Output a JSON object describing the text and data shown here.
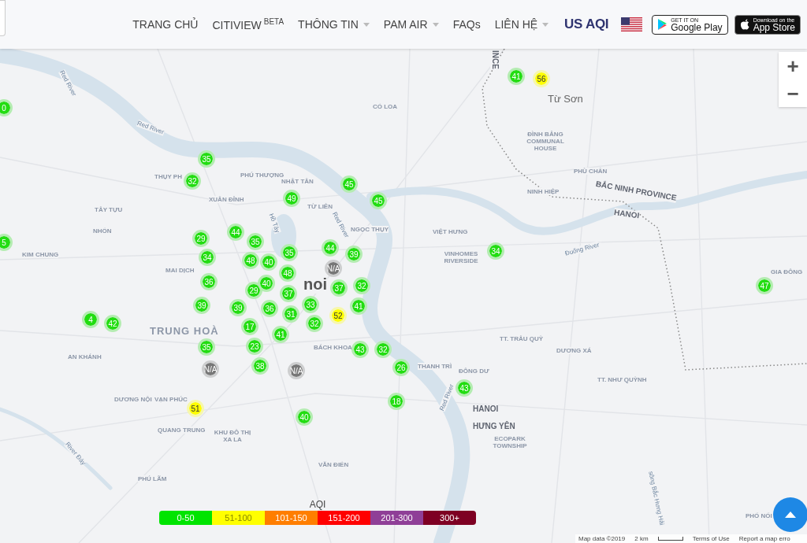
{
  "nav": {
    "items": [
      {
        "label": "TRANG CHỦ",
        "dropdown": false
      },
      {
        "label": "CITIVIEW",
        "badge": "BETA",
        "dropdown": false
      },
      {
        "label": "THÔNG TIN",
        "dropdown": true
      },
      {
        "label": "PAM AIR",
        "dropdown": true
      },
      {
        "label": "FAQs",
        "dropdown": false
      },
      {
        "label": "LIÊN HỆ",
        "dropdown": true
      }
    ],
    "aqi_logo": "US AQI",
    "store_badges": [
      {
        "kind": "google",
        "small": "GET IT ON",
        "big": "Google Play"
      },
      {
        "kind": "apple",
        "small": "Download on the",
        "big": "App Store"
      }
    ]
  },
  "zoom_controls": [
    "+",
    "−"
  ],
  "map": {
    "labels": [
      {
        "kind": "region",
        "text": "INCE"
      },
      {
        "kind": "water",
        "text": "Red River"
      },
      {
        "kind": "water",
        "text": "Red River"
      },
      {
        "kind": "place",
        "text": "CỔ LOA"
      },
      {
        "kind": "town",
        "text": "Từ Sơn"
      },
      {
        "kind": "place",
        "text": "ĐÌNH BẢNG COMMUNAL HOUSE"
      },
      {
        "kind": "place",
        "text": "THỤY PH"
      },
      {
        "kind": "place",
        "text": "PHÚ THƯỢNG"
      },
      {
        "kind": "place",
        "text": "PHÙ CHẨN"
      },
      {
        "kind": "region",
        "text": "BẮC NINH PROVINCE"
      },
      {
        "kind": "place",
        "text": "XUÂN ĐỈNH"
      },
      {
        "kind": "place",
        "text": "NHẬT TÂN"
      },
      {
        "kind": "place",
        "text": "NINH HIỆP"
      },
      {
        "kind": "place",
        "text": "TỪ LIÊN"
      },
      {
        "kind": "region",
        "text": "HANOI"
      },
      {
        "kind": "place",
        "text": "TÂY TỰU"
      },
      {
        "kind": "place",
        "text": "NHỔN"
      },
      {
        "kind": "place",
        "text": "NGỌC THỤY"
      },
      {
        "kind": "place",
        "text": "VIỆT HƯNG"
      },
      {
        "kind": "water",
        "text": "Hồ Tây"
      },
      {
        "kind": "water",
        "text": "Red River"
      },
      {
        "kind": "place",
        "text": "KIM CHUNG"
      },
      {
        "kind": "place",
        "text": "VINHOMES RIVERSIDE"
      },
      {
        "kind": "water",
        "text": "Đuống River"
      },
      {
        "kind": "place",
        "text": "MAI DỊCH"
      },
      {
        "kind": "place",
        "text": "GIA ĐÔNG"
      },
      {
        "kind": "city",
        "text": "noi"
      },
      {
        "kind": "district",
        "text": "TRUNG HOÀ"
      },
      {
        "kind": "place",
        "text": "BÁCH KHOA"
      },
      {
        "kind": "place",
        "text": "TT. TRÂU QUỲ"
      },
      {
        "kind": "place",
        "text": "DƯƠNG XÁ"
      },
      {
        "kind": "place",
        "text": "AN KHÁNH"
      },
      {
        "kind": "place",
        "text": "THANH TRÌ"
      },
      {
        "kind": "place",
        "text": "ĐÔNG DƯ"
      },
      {
        "kind": "place",
        "text": "TT. NHƯ QUỲNH"
      },
      {
        "kind": "place",
        "text": "DƯƠNG NỘI"
      },
      {
        "kind": "place",
        "text": "VẠN PHÚC"
      },
      {
        "kind": "region",
        "text": "HANOI"
      },
      {
        "kind": "region",
        "text": "HƯNG YÊN"
      },
      {
        "kind": "place",
        "text": "ECOPARK TOWNSHIP"
      },
      {
        "kind": "place",
        "text": "QUANG TRUNG"
      },
      {
        "kind": "place",
        "text": "KHU ĐÔ THỊ XA LA"
      },
      {
        "kind": "water",
        "text": "River Đáy"
      },
      {
        "kind": "water",
        "text": "Red River"
      },
      {
        "kind": "place",
        "text": "VĂN ĐIỂN"
      },
      {
        "kind": "place",
        "text": "PHÚ LÃM"
      },
      {
        "kind": "water",
        "text": "sông Bắc Hưng Hải"
      },
      {
        "kind": "place",
        "text": "PHỐ NỐI"
      }
    ],
    "markers": [
      {
        "aqi": "41",
        "color": "#22dd11"
      },
      {
        "aqi": "56",
        "color": "#ffff00"
      },
      {
        "aqi": "0",
        "color": "#22dd11"
      },
      {
        "aqi": "35",
        "color": "#22dd11"
      },
      {
        "aqi": "32",
        "color": "#22dd11"
      },
      {
        "aqi": "45",
        "color": "#22dd11"
      },
      {
        "aqi": "49",
        "color": "#22dd11"
      },
      {
        "aqi": "45",
        "color": "#22dd11"
      },
      {
        "aqi": "5",
        "color": "#22dd11"
      },
      {
        "aqi": "29",
        "color": "#22dd11"
      },
      {
        "aqi": "44",
        "color": "#22dd11"
      },
      {
        "aqi": "35",
        "color": "#22dd11"
      },
      {
        "aqi": "35",
        "color": "#22dd11"
      },
      {
        "aqi": "44",
        "color": "#22dd11"
      },
      {
        "aqi": "39",
        "color": "#22dd11"
      },
      {
        "aqi": "34",
        "color": "#22dd11"
      },
      {
        "aqi": "34",
        "color": "#22dd11"
      },
      {
        "aqi": "48",
        "color": "#22dd11"
      },
      {
        "aqi": "40",
        "color": "#22dd11"
      },
      {
        "aqi": "N/A",
        "color": "#777777"
      },
      {
        "aqi": "48",
        "color": "#22dd11"
      },
      {
        "aqi": "36",
        "color": "#22dd11"
      },
      {
        "aqi": "29",
        "color": "#22dd11"
      },
      {
        "aqi": "40",
        "color": "#22dd11"
      },
      {
        "aqi": "37",
        "color": "#22dd11"
      },
      {
        "aqi": "37",
        "color": "#22dd11"
      },
      {
        "aqi": "32",
        "color": "#22dd11"
      },
      {
        "aqi": "47",
        "color": "#22dd11"
      },
      {
        "aqi": "39",
        "color": "#22dd11"
      },
      {
        "aqi": "39",
        "color": "#22dd11"
      },
      {
        "aqi": "36",
        "color": "#22dd11"
      },
      {
        "aqi": "31",
        "color": "#22dd11"
      },
      {
        "aqi": "33",
        "color": "#22dd11"
      },
      {
        "aqi": "52",
        "color": "#ffff00"
      },
      {
        "aqi": "41",
        "color": "#22dd11"
      },
      {
        "aqi": "4",
        "color": "#22dd11"
      },
      {
        "aqi": "42",
        "color": "#22dd11"
      },
      {
        "aqi": "17",
        "color": "#22dd11"
      },
      {
        "aqi": "41",
        "color": "#22dd11"
      },
      {
        "aqi": "32",
        "color": "#22dd11"
      },
      {
        "aqi": "35",
        "color": "#22dd11"
      },
      {
        "aqi": "23",
        "color": "#22dd11"
      },
      {
        "aqi": "43",
        "color": "#22dd11"
      },
      {
        "aqi": "32",
        "color": "#22dd11"
      },
      {
        "aqi": "N/A",
        "color": "#777777"
      },
      {
        "aqi": "38",
        "color": "#22dd11"
      },
      {
        "aqi": "N/A",
        "color": "#777777"
      },
      {
        "aqi": "26",
        "color": "#22dd11"
      },
      {
        "aqi": "51",
        "color": "#ffff00"
      },
      {
        "aqi": "40",
        "color": "#22dd11"
      },
      {
        "aqi": "18",
        "color": "#22dd11"
      },
      {
        "aqi": "43",
        "color": "#22dd11"
      }
    ]
  },
  "legend": {
    "title": "AQI",
    "ranges": [
      {
        "label": "0-50",
        "color": "#00e400"
      },
      {
        "label": "51-100",
        "color": "#ffff00"
      },
      {
        "label": "101-150",
        "color": "#ff7e00"
      },
      {
        "label": "151-200",
        "color": "#ff0000"
      },
      {
        "label": "201-300",
        "color": "#8f3f97"
      },
      {
        "label": "300+",
        "color": "#7e0023"
      }
    ]
  },
  "attribution": {
    "map_data": "Map data ©2019",
    "scale": "2 km",
    "terms": "Terms of Use",
    "report": "Report a map erro"
  }
}
